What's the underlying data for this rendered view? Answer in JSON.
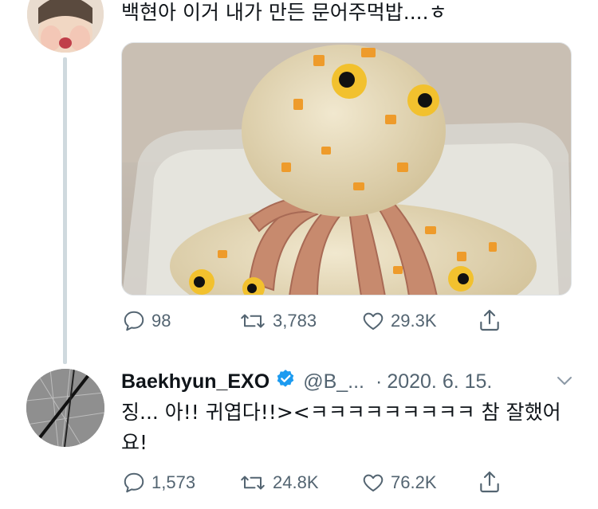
{
  "top_tweet": {
    "text": "백현아 이거 내가 만든 문어주먹밥....ㅎ",
    "media_alt_icon": "octopus-rice-ball-photo",
    "stats": {
      "replies": "98",
      "retweets": "3,783",
      "likes": "29.3K"
    }
  },
  "reply_tweet": {
    "display_name": "Baekhyun_EXO",
    "handle": "@B_...",
    "separator": "·",
    "date": "2020. 6. 15.",
    "text": "징... 아!! 귀엽다!!><ㅋㅋㅋㅋㅋㅋㅋㅋㅋ 참 잘했어요!",
    "stats": {
      "replies": "1,573",
      "retweets": "24.8K",
      "likes": "76.2K"
    }
  },
  "colors": {
    "text_primary": "#0f1419",
    "text_secondary": "#536471",
    "verified_blue": "#1d9bf0",
    "thread_line": "#cfd9de"
  }
}
